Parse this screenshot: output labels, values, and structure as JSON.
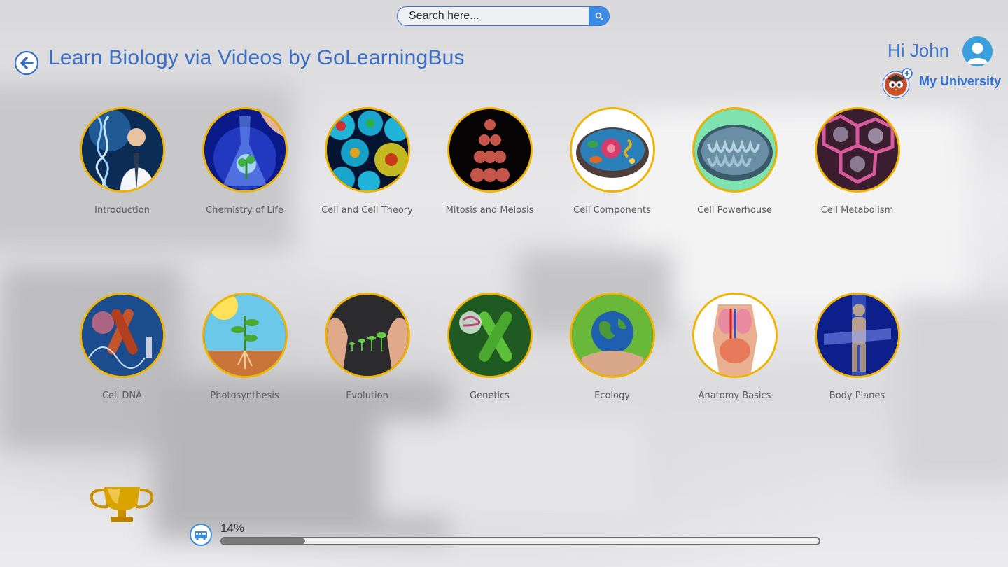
{
  "search": {
    "placeholder": "Search here..."
  },
  "header": {
    "title": "Learn Biology via Videos by GoLearningBus"
  },
  "user": {
    "greeting": "Hi John",
    "university_label": "My University"
  },
  "colors": {
    "accent": "#3a6fc4",
    "ring": "#f0b400",
    "search_button": "#3b8ce8"
  },
  "topics": [
    {
      "label": "Introduction"
    },
    {
      "label": "Chemistry of Life"
    },
    {
      "label": "Cell and Cell Theory"
    },
    {
      "label": "Mitosis and Meiosis"
    },
    {
      "label": "Cell Components"
    },
    {
      "label": "Cell Powerhouse"
    },
    {
      "label": "Cell Metabolism"
    },
    {
      "label": "Cell DNA"
    },
    {
      "label": "Photosynthesis"
    },
    {
      "label": "Evolution"
    },
    {
      "label": "Genetics"
    },
    {
      "label": "Ecology"
    },
    {
      "label": "Anatomy Basics"
    },
    {
      "label": "Body Planes"
    }
  ],
  "progress": {
    "text": "14%",
    "value": 0.14
  }
}
